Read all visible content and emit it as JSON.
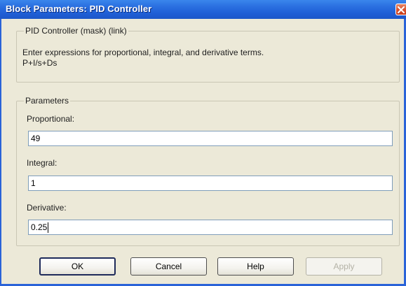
{
  "window": {
    "title": "Block Parameters: PID Controller"
  },
  "mask_group": {
    "legend": "PID Controller (mask) (link)",
    "description": "Enter expressions for proportional, integral, and derivative terms.",
    "formula": "P+I/s+Ds"
  },
  "parameters": {
    "legend": "Parameters",
    "proportional": {
      "label": "Proportional:",
      "value": "49"
    },
    "integral": {
      "label": "Integral:",
      "value": "1"
    },
    "derivative": {
      "label": "Derivative:",
      "value": "0.25"
    }
  },
  "buttons": {
    "ok": "OK",
    "cancel": "Cancel",
    "help": "Help",
    "apply": "Apply"
  },
  "icons": {
    "close": "close-icon"
  },
  "colors": {
    "titlebar": "#2a6fe0",
    "dialog_bg": "#ece9d8",
    "close_button": "#d9532f"
  }
}
